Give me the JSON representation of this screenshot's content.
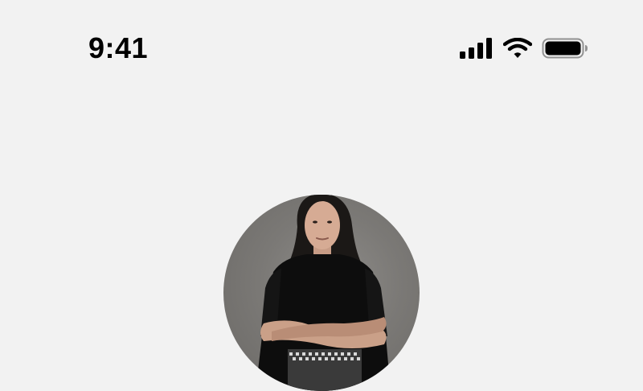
{
  "status_bar": {
    "time": "9:41",
    "icons": [
      "cellular-signal-icon",
      "wifi-icon",
      "battery-icon"
    ]
  },
  "profile": {
    "avatar": "profile-photo"
  }
}
